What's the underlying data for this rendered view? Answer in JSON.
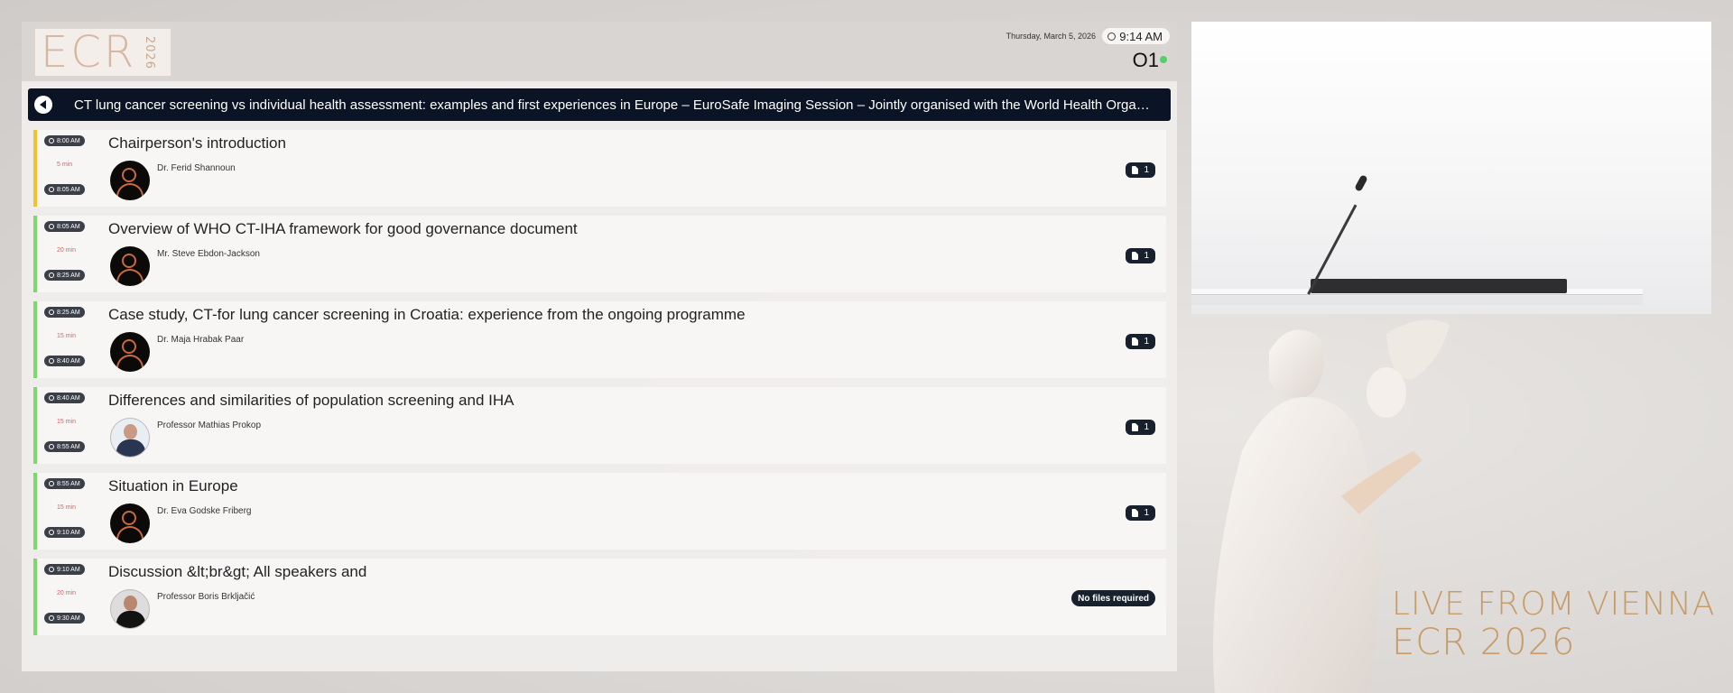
{
  "header": {
    "logo_text": "ECR",
    "logo_year": "2026",
    "date": "Thursday, March 5, 2026",
    "time": "9:14 AM",
    "room": "O1"
  },
  "session": {
    "title": "CT lung cancer screening vs individual health assessment: examples and first experiences in Europe – EuroSafe Imaging Session – Jointly organised with the World Health Organizatio..."
  },
  "talks": [
    {
      "start": "8:00 AM",
      "duration": "5 min",
      "end": "8:05 AM",
      "title": "Chairperson's introduction",
      "speaker": "Dr. Ferid Shannoun",
      "files": "1"
    },
    {
      "start": "8:05 AM",
      "duration": "20 min",
      "end": "8:25 AM",
      "title": "Overview of WHO CT-IHA framework for good governance document",
      "speaker": "Mr. Steve Ebdon-Jackson",
      "files": "1"
    },
    {
      "start": "8:25 AM",
      "duration": "15 min",
      "end": "8:40 AM",
      "title": "Case study, CT-for lung cancer screening in Croatia: experience from the ongoing programme",
      "speaker": "Dr. Maja Hrabak Paar",
      "files": "1"
    },
    {
      "start": "8:40 AM",
      "duration": "15 min",
      "end": "8:55 AM",
      "title": "Differences and similarities of population screening and IHA",
      "speaker": "Professor Mathias Prokop",
      "files": "1"
    },
    {
      "start": "8:55 AM",
      "duration": "15 min",
      "end": "9:10 AM",
      "title": "Situation in Europe",
      "speaker": "Dr. Eva Godske Friberg",
      "files": "1"
    },
    {
      "start": "9:10 AM",
      "duration": "20 min",
      "end": "9:30 AM",
      "title": "Discussion &lt;br&gt; All speakers and",
      "speaker": "Professor Boris Brkljačić",
      "no_files": "No files required"
    }
  ],
  "branding": {
    "live_text": "LIVE FROM VIENNA",
    "ecr_text": "ECR 2026"
  },
  "colors": {
    "session_bar": "#0b1425",
    "live_indicator": "#54d069",
    "first_row_accent": "#f2c22e",
    "row_accent": "#7ad96a",
    "duration_text": "#e35c5c",
    "gold": "#c89c68"
  }
}
